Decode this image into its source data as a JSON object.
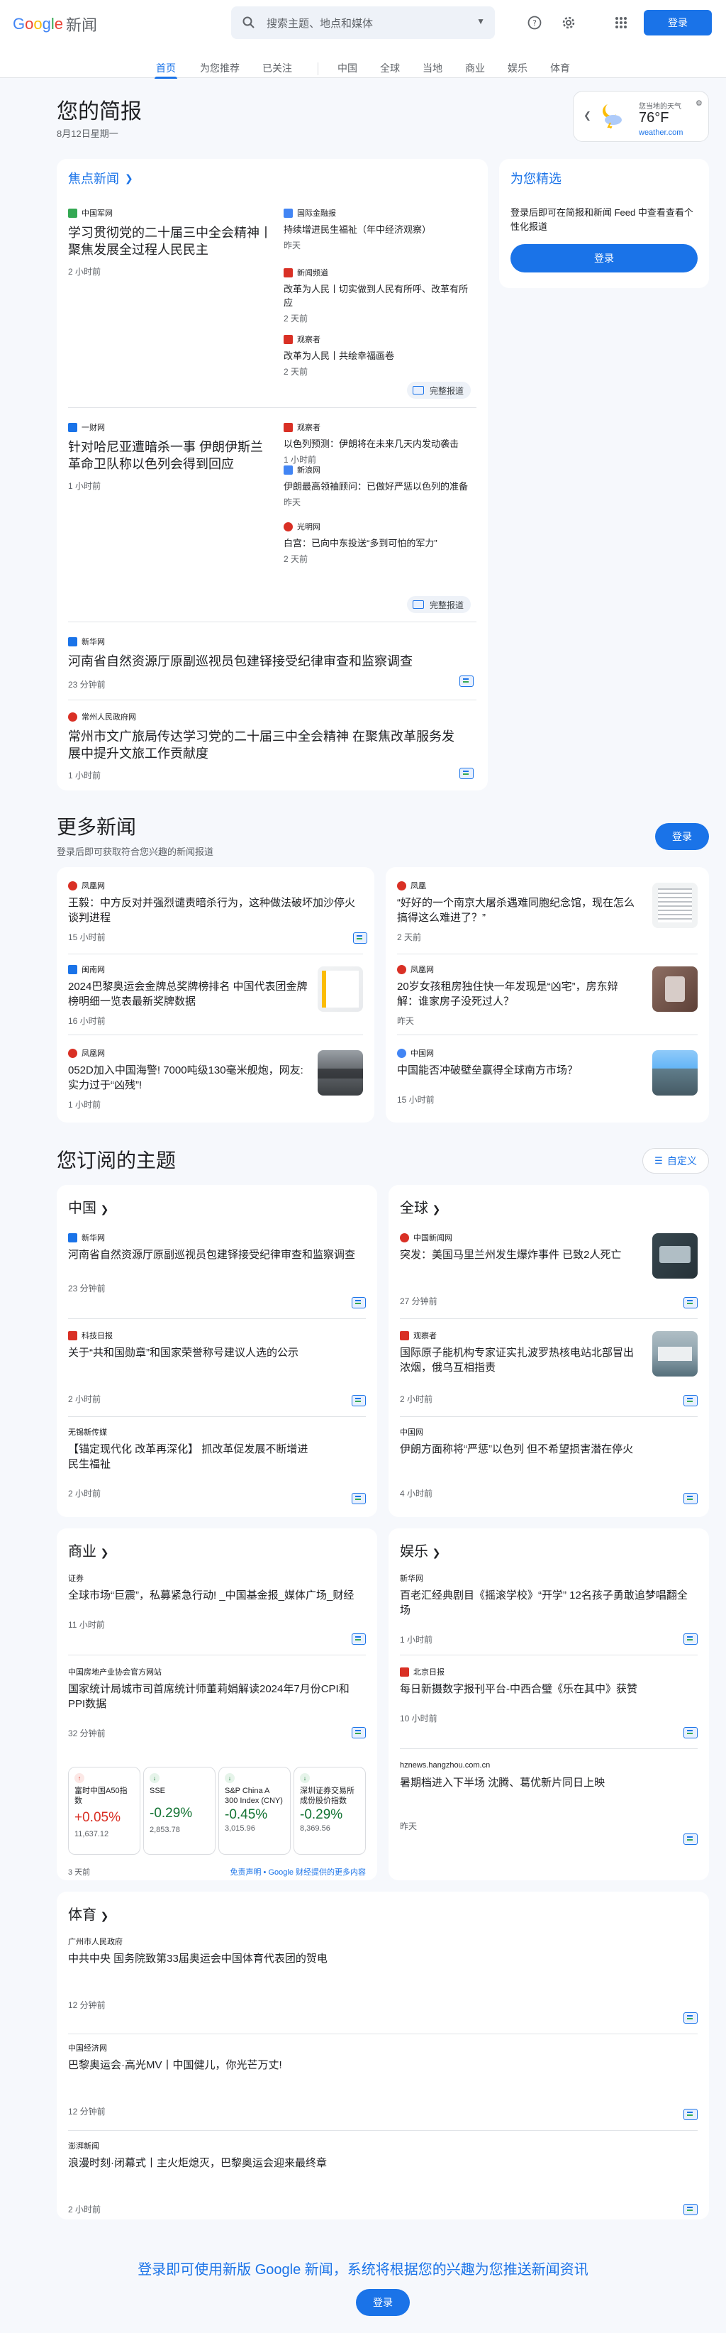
{
  "header": {
    "logo_google": "Google",
    "logo_news": "新闻",
    "search_placeholder": "搜索主题、地点和媒体",
    "login": "登录"
  },
  "nav": {
    "tabs": [
      "首页",
      "为您推荐",
      "已关注",
      "中国",
      "全球",
      "当地",
      "商业",
      "娱乐",
      "体育"
    ]
  },
  "briefing": {
    "title": "您的简报",
    "date": "8月12日星期一",
    "weather": {
      "location": "您当地的天气",
      "temp": "76°F",
      "source": "weather.com"
    }
  },
  "top_stories": {
    "title": "焦点新闻",
    "full_coverage": "完整报道",
    "clusters": [
      {
        "main": {
          "source": "中国军网",
          "headline": "学习贯彻党的二十届三中全会精神丨聚焦发展全过程人民民主",
          "time": "2 小时前"
        },
        "related": [
          {
            "source": "国际金融报",
            "headline": "持续增进民生福祉（年中经济观察）",
            "time": "昨天"
          },
          {
            "source": "新闻频道",
            "headline": "改革为人民丨切实做到人民有所呼、改革有所应",
            "time": "2 天前"
          },
          {
            "source": "观察者",
            "headline": "改革为人民丨共绘幸福画卷",
            "time": "2 天前"
          }
        ]
      },
      {
        "main": {
          "source": "一财网",
          "headline": "针对哈尼亚遭暗杀一事 伊朗伊斯兰革命卫队称以色列会得到回应",
          "time": "1 小时前"
        },
        "related": [
          {
            "source": "观察者",
            "headline": "以色列预测：伊朗将在未来几天内发动袭击",
            "time": "1 小时前"
          },
          {
            "source": "新浪网",
            "headline": "伊朗最高领袖顾问：已做好严惩以色列的准备",
            "time": "昨天"
          },
          {
            "source": "光明网",
            "headline": "白宫：已向中东投送“多到可怕的军力”",
            "time": "2 天前"
          }
        ]
      }
    ],
    "singles": [
      {
        "source": "新华网",
        "headline": "河南省自然资源厅原副巡视员包建铎接受纪律审查和监察调查",
        "time": "23 分钟前"
      },
      {
        "source": "常州人民政府网",
        "headline": "常州市文广旅局传达学习党的二十届三中全会精神 在聚焦改革服务发展中提升文旅工作贡献度",
        "time": "1 小时前"
      }
    ]
  },
  "picks": {
    "title": "为您精选",
    "text": "登录后即可在简报和新闻 Feed 中查看查看个性化报道",
    "login": "登录"
  },
  "more_news": {
    "title": "更多新闻",
    "subtitle": "登录后即可获取符合您兴趣的新闻报道",
    "login": "登录",
    "items": [
      {
        "source": "凤凰网",
        "headline": "王毅：中方反对并强烈谴责暗杀行为，这种做法破坏加沙停火谈判进程",
        "time": "15 小时前"
      },
      {
        "source": "凤凰",
        "headline": "“好好的一个南京大屠杀遇难同胞纪念馆，现在怎么搞得这么难进了？”",
        "time": "2 天前"
      },
      {
        "source": "闽南网",
        "headline": "2024巴黎奥运会金牌总奖牌榜排名 中国代表团金牌榜明细一览表最新奖牌数据",
        "time": "16 小时前"
      },
      {
        "source": "凤凰网",
        "headline": "20岁女孩租房独住快一年发现是“凶宅”，房东辩解：谁家房子没死过人？",
        "time": "昨天"
      },
      {
        "source": "凤凰网",
        "headline": "052D加入中国海警! 7000吨级130毫米舰炮，网友:实力过于“凶残”!",
        "time": "1 小时前"
      },
      {
        "source": "中国网",
        "headline": "中国能否冲破壁垒赢得全球南方市场？",
        "time": "15 小时前"
      }
    ]
  },
  "topics": {
    "title": "您订阅的主题",
    "customize": "自定义",
    "china": {
      "title": "中国",
      "items": [
        {
          "source": "新华网",
          "headline": "河南省自然资源厅原副巡视员包建铎接受纪律审查和监察调查",
          "time": "23 分钟前"
        },
        {
          "source": "科技日报",
          "headline": "关于“共和国勋章”和国家荣誉称号建议人选的公示",
          "time": "2 小时前"
        },
        {
          "source": "无锡新传媒",
          "headline": "【锚定现代化 改革再深化】 抓改革促发展不断增进民生福祉",
          "time": "2 小时前"
        }
      ]
    },
    "world": {
      "title": "全球",
      "items": [
        {
          "source": "中国新闻网",
          "headline": "突发：美国马里兰州发生爆炸事件 已致2人死亡",
          "time": "27 分钟前"
        },
        {
          "source": "观察者",
          "headline": "国际原子能机构专家证实扎波罗热核电站北部冒出浓烟，俄乌互相指责",
          "time": "2 小时前"
        },
        {
          "source": "中国网",
          "headline": "伊朗方面称将“严惩”以色列 但不希望损害潜在停火",
          "time": "4 小时前"
        }
      ]
    },
    "business": {
      "title": "商业",
      "items": [
        {
          "source": "证券",
          "headline": "全球市场“巨震”，私募紧急行动! _中国基金报_媒体广场_财经",
          "time": "11 小时前"
        },
        {
          "source": "中国房地产业协会官方网站",
          "headline": "国家统计局城市司首席统计师董莉娟解读2024年7月份CPI和PPI数据",
          "time": "32 分钟前"
        }
      ],
      "markets": [
        {
          "name": "富时中国A50指数",
          "pct": "+0.05%",
          "value": "11,637.12",
          "dir": "up"
        },
        {
          "name": "SSE",
          "pct": "-0.29%",
          "value": "2,853.78",
          "dir": "down"
        },
        {
          "name": "S&P China A 300 Index (CNY)",
          "pct": "-0.45%",
          "value": "3,015.96",
          "dir": "down"
        },
        {
          "name": "深圳证券交易所成份股价指数",
          "pct": "-0.29%",
          "value": "8,369.56",
          "dir": "down"
        }
      ],
      "market_time": "3 天前",
      "disclaimer": "免责声明",
      "provider": " • Google 财经提供的更多内容"
    },
    "entertainment": {
      "title": "娱乐",
      "items": [
        {
          "source": "新华网",
          "headline": "百老汇经典剧目《摇滚学校》“开学” 12名孩子勇敢追梦唱翻全场",
          "time": "1 小时前"
        },
        {
          "source": "北京日报",
          "headline": "每日新摄数字报刊平台-中西合璧《乐在其中》获赞",
          "time": "10 小时前"
        },
        {
          "source": "hznews.hangzhou.com.cn",
          "headline": "暑期档进入下半场 沈腾、葛优新片同日上映",
          "time": "昨天"
        }
      ]
    },
    "sports": {
      "title": "体育",
      "items": [
        {
          "source": "广州市人民政府",
          "headline": "中共中央 国务院致第33届奥运会中国体育代表团的贺电",
          "time": "12 分钟前"
        },
        {
          "source": "中国经济网",
          "headline": "巴黎奥运会·高光MV丨中国健儿，你光芒万丈!",
          "time": "12 分钟前"
        },
        {
          "source": "澎湃新闻",
          "headline": "浪漫时刻·闭幕式丨主火炬熄灭，巴黎奥运会迎来最终章",
          "time": "2 小时前"
        }
      ]
    }
  },
  "footer": {
    "text": "登录即可使用新版 Google 新闻，系统将根据您的兴趣为您推送新闻资讯",
    "login": "登录"
  },
  "colors": {
    "brand_blue": "#1a73e8",
    "background": "#f6f8fc",
    "positive": "#d93025",
    "negative": "#137333"
  }
}
